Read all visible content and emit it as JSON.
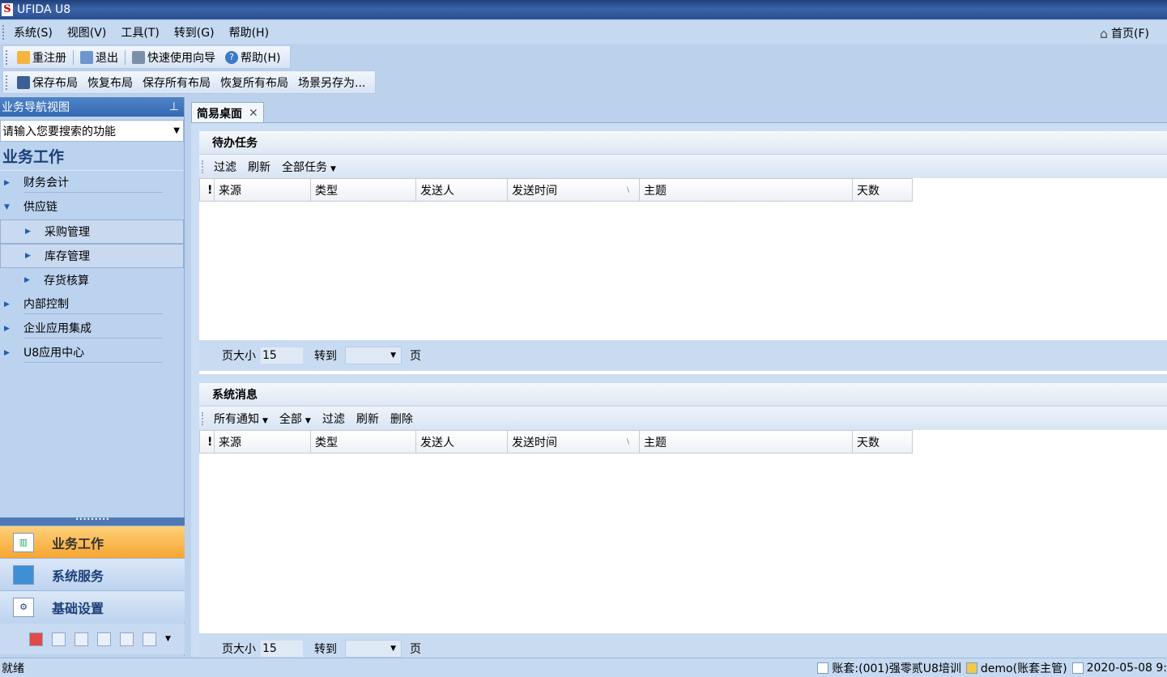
{
  "window": {
    "title": "UFIDA U8"
  },
  "menu": {
    "items": [
      "系统(S)",
      "视图(V)",
      "工具(T)",
      "转到(G)",
      "帮助(H)"
    ],
    "home": "首页(F)"
  },
  "toolbar1": {
    "relogin": "重注册",
    "exit": "退出",
    "wizard": "快速使用向导",
    "help": "帮助(H)"
  },
  "toolbar2": {
    "save_layout": "保存布局",
    "restore_layout": "恢复布局",
    "save_all": "保存所有布局",
    "restore_all": "恢复所有布局",
    "save_scene": "场景另存为..."
  },
  "nav": {
    "header": "业务导航视图",
    "search_placeholder": "请输入您要搜索的功能",
    "section": "业务工作",
    "tree": [
      {
        "label": "财务会计",
        "expanded": false
      },
      {
        "label": "供应链",
        "expanded": true
      },
      {
        "label": "采购管理"
      },
      {
        "label": "库存管理"
      },
      {
        "label": "存货核算"
      },
      {
        "label": "内部控制",
        "expanded": false
      },
      {
        "label": "企业应用集成",
        "expanded": false
      },
      {
        "label": "U8应用中心",
        "expanded": false
      }
    ],
    "buttons": [
      "业务工作",
      "系统服务",
      "基础设置"
    ]
  },
  "tabs": {
    "active": "简易桌面"
  },
  "todo": {
    "title": "待办任务",
    "toolbar": {
      "filter": "过滤",
      "refresh": "刷新",
      "all_tasks": "全部任务"
    },
    "columns": [
      "!",
      "来源",
      "类型",
      "发送人",
      "发送时间",
      "主题",
      "天数"
    ],
    "pager": {
      "size_label": "页大小",
      "size": "15",
      "goto": "转到",
      "page": "页"
    }
  },
  "messages": {
    "title": "系统消息",
    "toolbar": {
      "all_notices": "所有通知",
      "all": "全部",
      "filter": "过滤",
      "refresh": "刷新",
      "delete": "删除"
    },
    "columns": [
      "!",
      "来源",
      "类型",
      "发送人",
      "发送时间",
      "主题",
      "天数"
    ],
    "pager": {
      "size_label": "页大小",
      "size": "15",
      "goto": "转到",
      "page": "页"
    }
  },
  "status": {
    "ready": "就绪",
    "account": "账套:(001)强零贰U8培训",
    "user": "demo(账套主管)",
    "date": "2020-05-08 9:"
  }
}
